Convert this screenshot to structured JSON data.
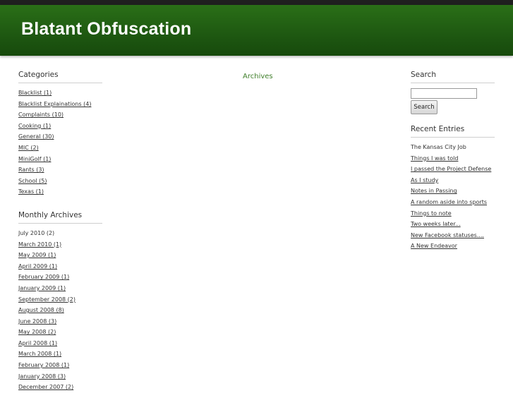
{
  "site": {
    "title": "Blatant Obfuscation"
  },
  "main": {
    "archives_label": "Archives"
  },
  "sidebar_left": {
    "categories": {
      "title": "Categories",
      "items": [
        "Blacklist (1)",
        "Blacklist Explainations (4)",
        "Complaints (10)",
        "Cooking (1)",
        "General (30)",
        "MIC (2)",
        "MiniGolf (1)",
        "Rants (3)",
        "School (5)",
        "Texas (1)"
      ]
    },
    "monthly_archives": {
      "title": "Monthly Archives",
      "items": [
        "July 2010 (2)",
        "March 2010 (1)",
        "May 2009 (1)",
        "April 2009 (1)",
        "February 2009 (1)",
        "January 2009 (1)",
        "September 2008 (2)",
        "August 2008 (8)",
        "June 2008 (3)",
        "May 2008 (2)",
        "April 2008 (1)",
        "March 2008 (1)",
        "February 2008 (1)",
        "January 2008 (3)",
        "December 2007 (2)"
      ]
    }
  },
  "sidebar_right": {
    "search": {
      "title": "Search",
      "input_value": "",
      "button_label": "Search"
    },
    "recent_entries": {
      "title": "Recent Entries",
      "items": [
        "The Kansas City Job",
        "Things I was told",
        "I passed the Project Defense",
        "As I study",
        "Notes in Passing",
        "A random aside into sports",
        "Things to note",
        "Two weeks later...",
        "New Facebook statuses....",
        "A New Endeavor"
      ]
    }
  }
}
